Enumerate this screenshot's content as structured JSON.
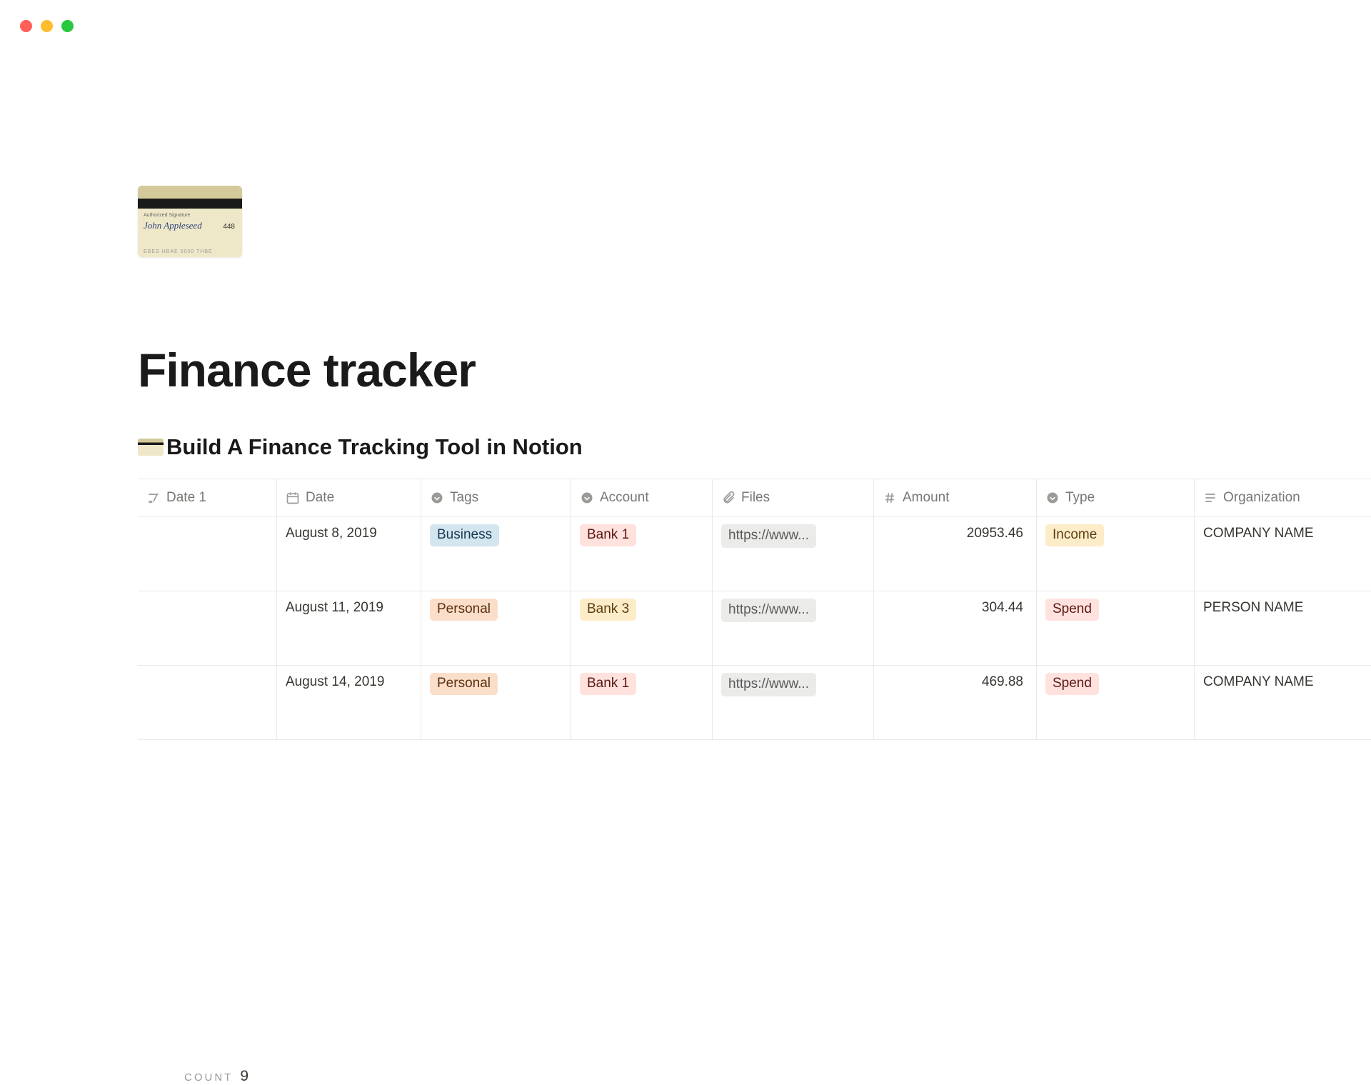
{
  "window": {
    "os": "mac"
  },
  "page": {
    "title": "Finance tracker",
    "subtitle_prefix_icon": "credit-card",
    "subtitle": "Build A Finance Tracking Tool in Notion",
    "big_icon": {
      "sig_label": "Authorized Signature",
      "sig": "John Appleseed",
      "num": "448",
      "bottom": "EBES  HBAE  5000  THBE"
    }
  },
  "table": {
    "columns": [
      {
        "key": "date1",
        "label": "Date 1",
        "icon": "title"
      },
      {
        "key": "date",
        "label": "Date",
        "icon": "calendar"
      },
      {
        "key": "tags",
        "label": "Tags",
        "icon": "select"
      },
      {
        "key": "account",
        "label": "Account",
        "icon": "select"
      },
      {
        "key": "files",
        "label": "Files",
        "icon": "attachment"
      },
      {
        "key": "amount",
        "label": "Amount",
        "icon": "number"
      },
      {
        "key": "type",
        "label": "Type",
        "icon": "select"
      },
      {
        "key": "org",
        "label": "Organization",
        "icon": "text"
      }
    ],
    "rows": [
      {
        "date1": "",
        "date": "August 8, 2019",
        "tag": "Business",
        "tag_class": "tag-business",
        "account": "Bank 1",
        "account_class": "tag-bank1",
        "file": "https://www...",
        "amount": "20953.46",
        "type": "Income",
        "type_class": "tag-income",
        "org": "COMPANY NAME"
      },
      {
        "date1": "",
        "date": "August 11, 2019",
        "tag": "Personal",
        "tag_class": "tag-personal",
        "account": "Bank 3",
        "account_class": "tag-bank3",
        "file": "https://www...",
        "amount": "304.44",
        "type": "Spend",
        "type_class": "tag-spend",
        "org": "PERSON NAME"
      },
      {
        "date1": "",
        "date": "August 14, 2019",
        "tag": "Personal",
        "tag_class": "tag-personal",
        "account": "Bank 1",
        "account_class": "tag-bank1",
        "file": "https://www...",
        "amount": "469.88",
        "type": "Spend",
        "type_class": "tag-spend",
        "org": "COMPANY NAME"
      }
    ],
    "footer": {
      "label": "COUNT",
      "value": "9"
    }
  }
}
